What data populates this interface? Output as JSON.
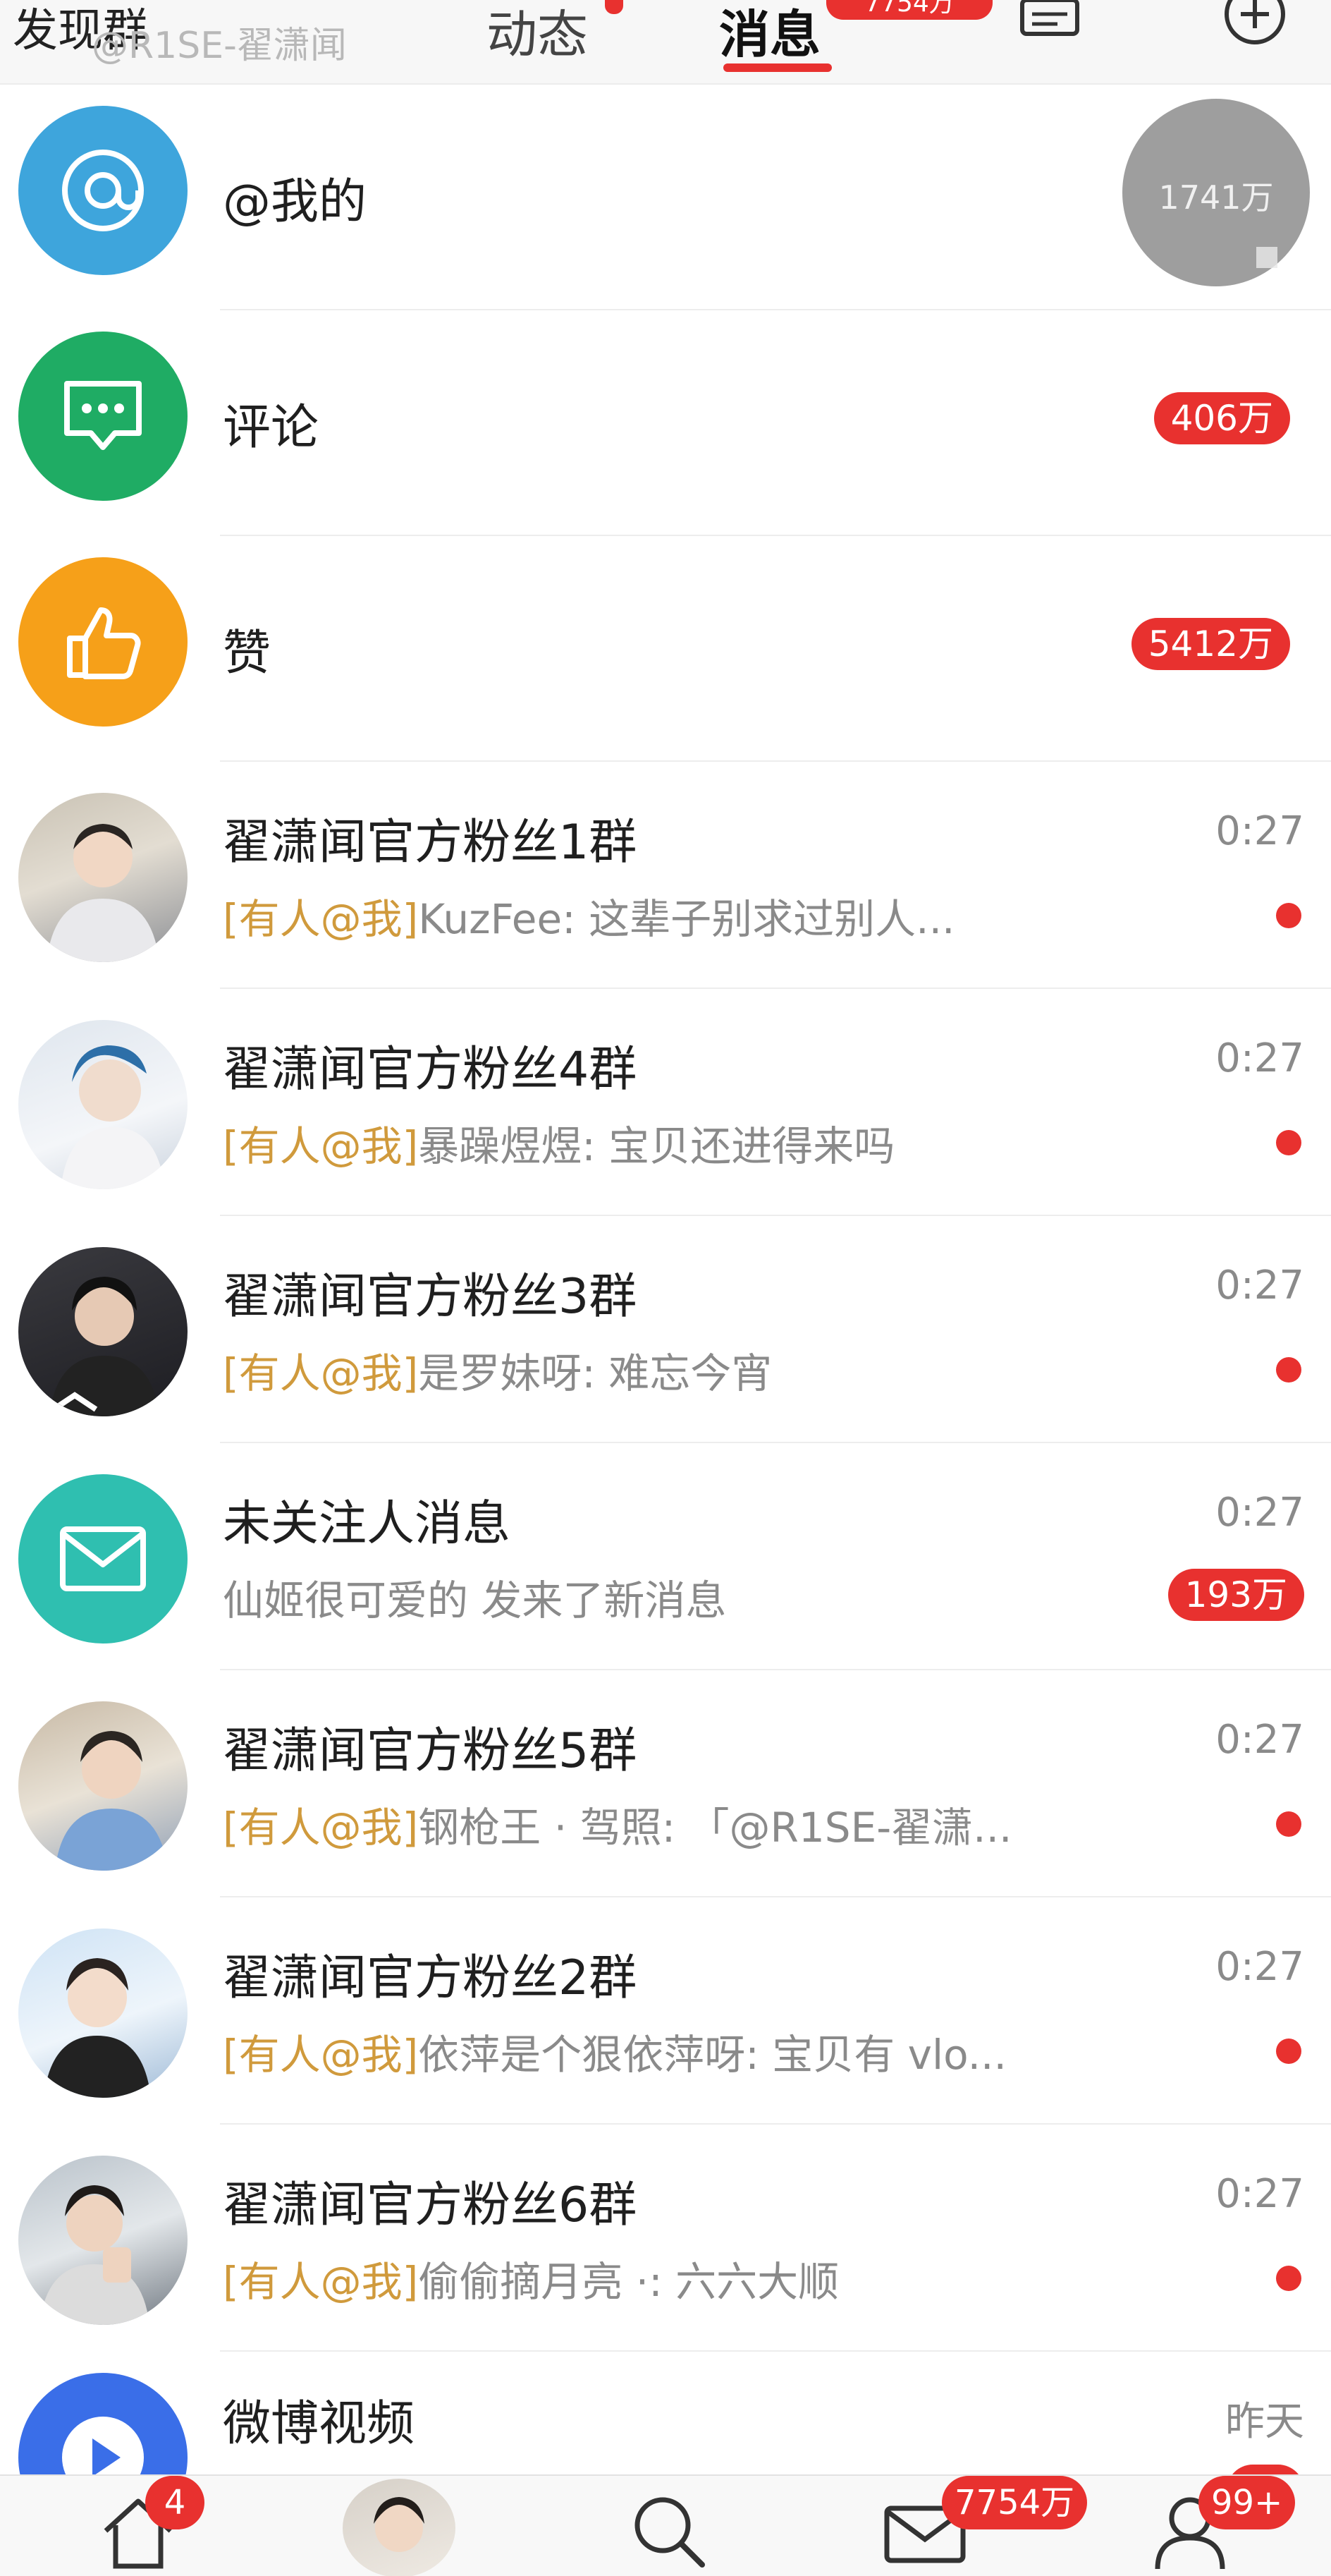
{
  "header": {
    "left_tab": "发现群",
    "watermark": "@R1SE-翟潇闻",
    "tab_dynamic": "动态",
    "tab_message": "消息",
    "top_badge": "7754万"
  },
  "overlay_badge": "1741万",
  "system_rows": [
    {
      "label": "@我的",
      "icon": "at-icon",
      "color": "#3ea5dc"
    },
    {
      "label": "评论",
      "icon": "comment-icon",
      "color": "#1fac64",
      "count": "406万"
    },
    {
      "label": "赞",
      "icon": "thumbs-up-icon",
      "color": "#f6a019",
      "count": "5412万"
    }
  ],
  "chat_rows": [
    {
      "title": "翟潇闻官方粉丝1群",
      "tag": "[有人@我]",
      "preview": "KuzFee: 这辈子别求过别人...",
      "time": "0:27",
      "unread_dot": true
    },
    {
      "title": "翟潇闻官方粉丝4群",
      "tag": "[有人@我]",
      "preview": "暴躁煜煜: 宝贝还进得来吗",
      "time": "0:27",
      "unread_dot": true
    },
    {
      "title": "翟潇闻官方粉丝3群",
      "tag": "[有人@我]",
      "preview": "是罗妹呀: 难忘今宵",
      "time": "0:27",
      "unread_dot": true
    },
    {
      "title": "未关注人消息",
      "tag": "",
      "preview": "仙姬很可爱的 发来了新消息",
      "time": "0:27",
      "count": "193万"
    },
    {
      "title": "翟潇闻官方粉丝5群",
      "tag": "[有人@我]",
      "preview": "钢枪王 · 驾照: 「@R1SE-翟潇...",
      "time": "0:27",
      "unread_dot": true
    },
    {
      "title": "翟潇闻官方粉丝2群",
      "tag": "[有人@我]",
      "preview": "依萍是个狠依萍呀: 宝贝有 vlo...",
      "time": "0:27",
      "unread_dot": true
    },
    {
      "title": "翟潇闻官方粉丝6群",
      "tag": "[有人@我]",
      "preview": "偷偷摘月亮 ·: 六六大顺",
      "time": "0:27",
      "unread_dot": true
    },
    {
      "title": "微博视频",
      "tag": "",
      "preview": "",
      "time": "昨天"
    }
  ],
  "bottom_nav": {
    "home_badge": "4",
    "message_badge": "7754万",
    "profile_badge": "99+"
  },
  "colors": {
    "accent_red": "#e8312f",
    "tag_gold": "#d09a3c",
    "mail_teal": "#2fbfb0",
    "video_blue": "#3a6ee8"
  }
}
